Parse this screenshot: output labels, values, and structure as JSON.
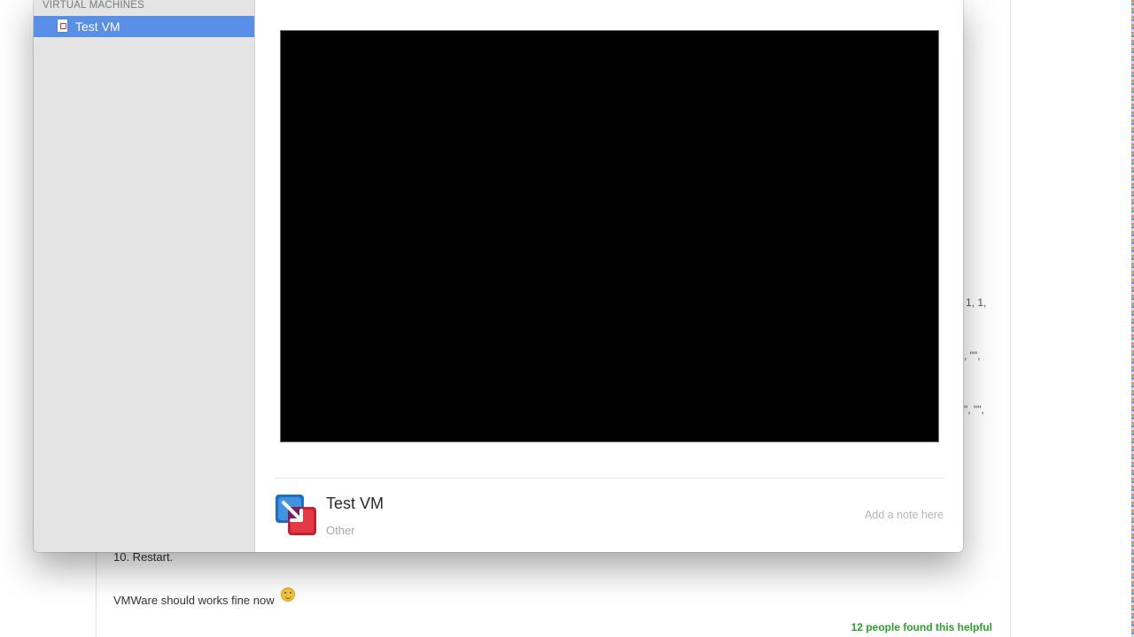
{
  "sidebar": {
    "section_title": "VIRTUAL MACHINES",
    "items": [
      {
        "label": "Test VM",
        "selected": true,
        "icon": "vm-file-icon"
      }
    ]
  },
  "vm_details": {
    "name": "Test VM",
    "os": "Other",
    "note_placeholder": "Add a note here",
    "logo_icon": "vmware-fusion-logo-icon"
  },
  "background_page": {
    "step_text": "10. Restart.",
    "result_text": "VMWare should works fine now",
    "emoji_icon": "smiley-icon",
    "helpful_text": "12 people found this helpful",
    "helpful_color": "#2aa02a",
    "code_fragments": [
      "1, 1,",
      ", \"\",",
      "\", \"\","
    ]
  },
  "colors": {
    "selection": "#5a8fe8",
    "sidebar_bg": "#e4e4e4",
    "vm_screen": "#000000"
  }
}
